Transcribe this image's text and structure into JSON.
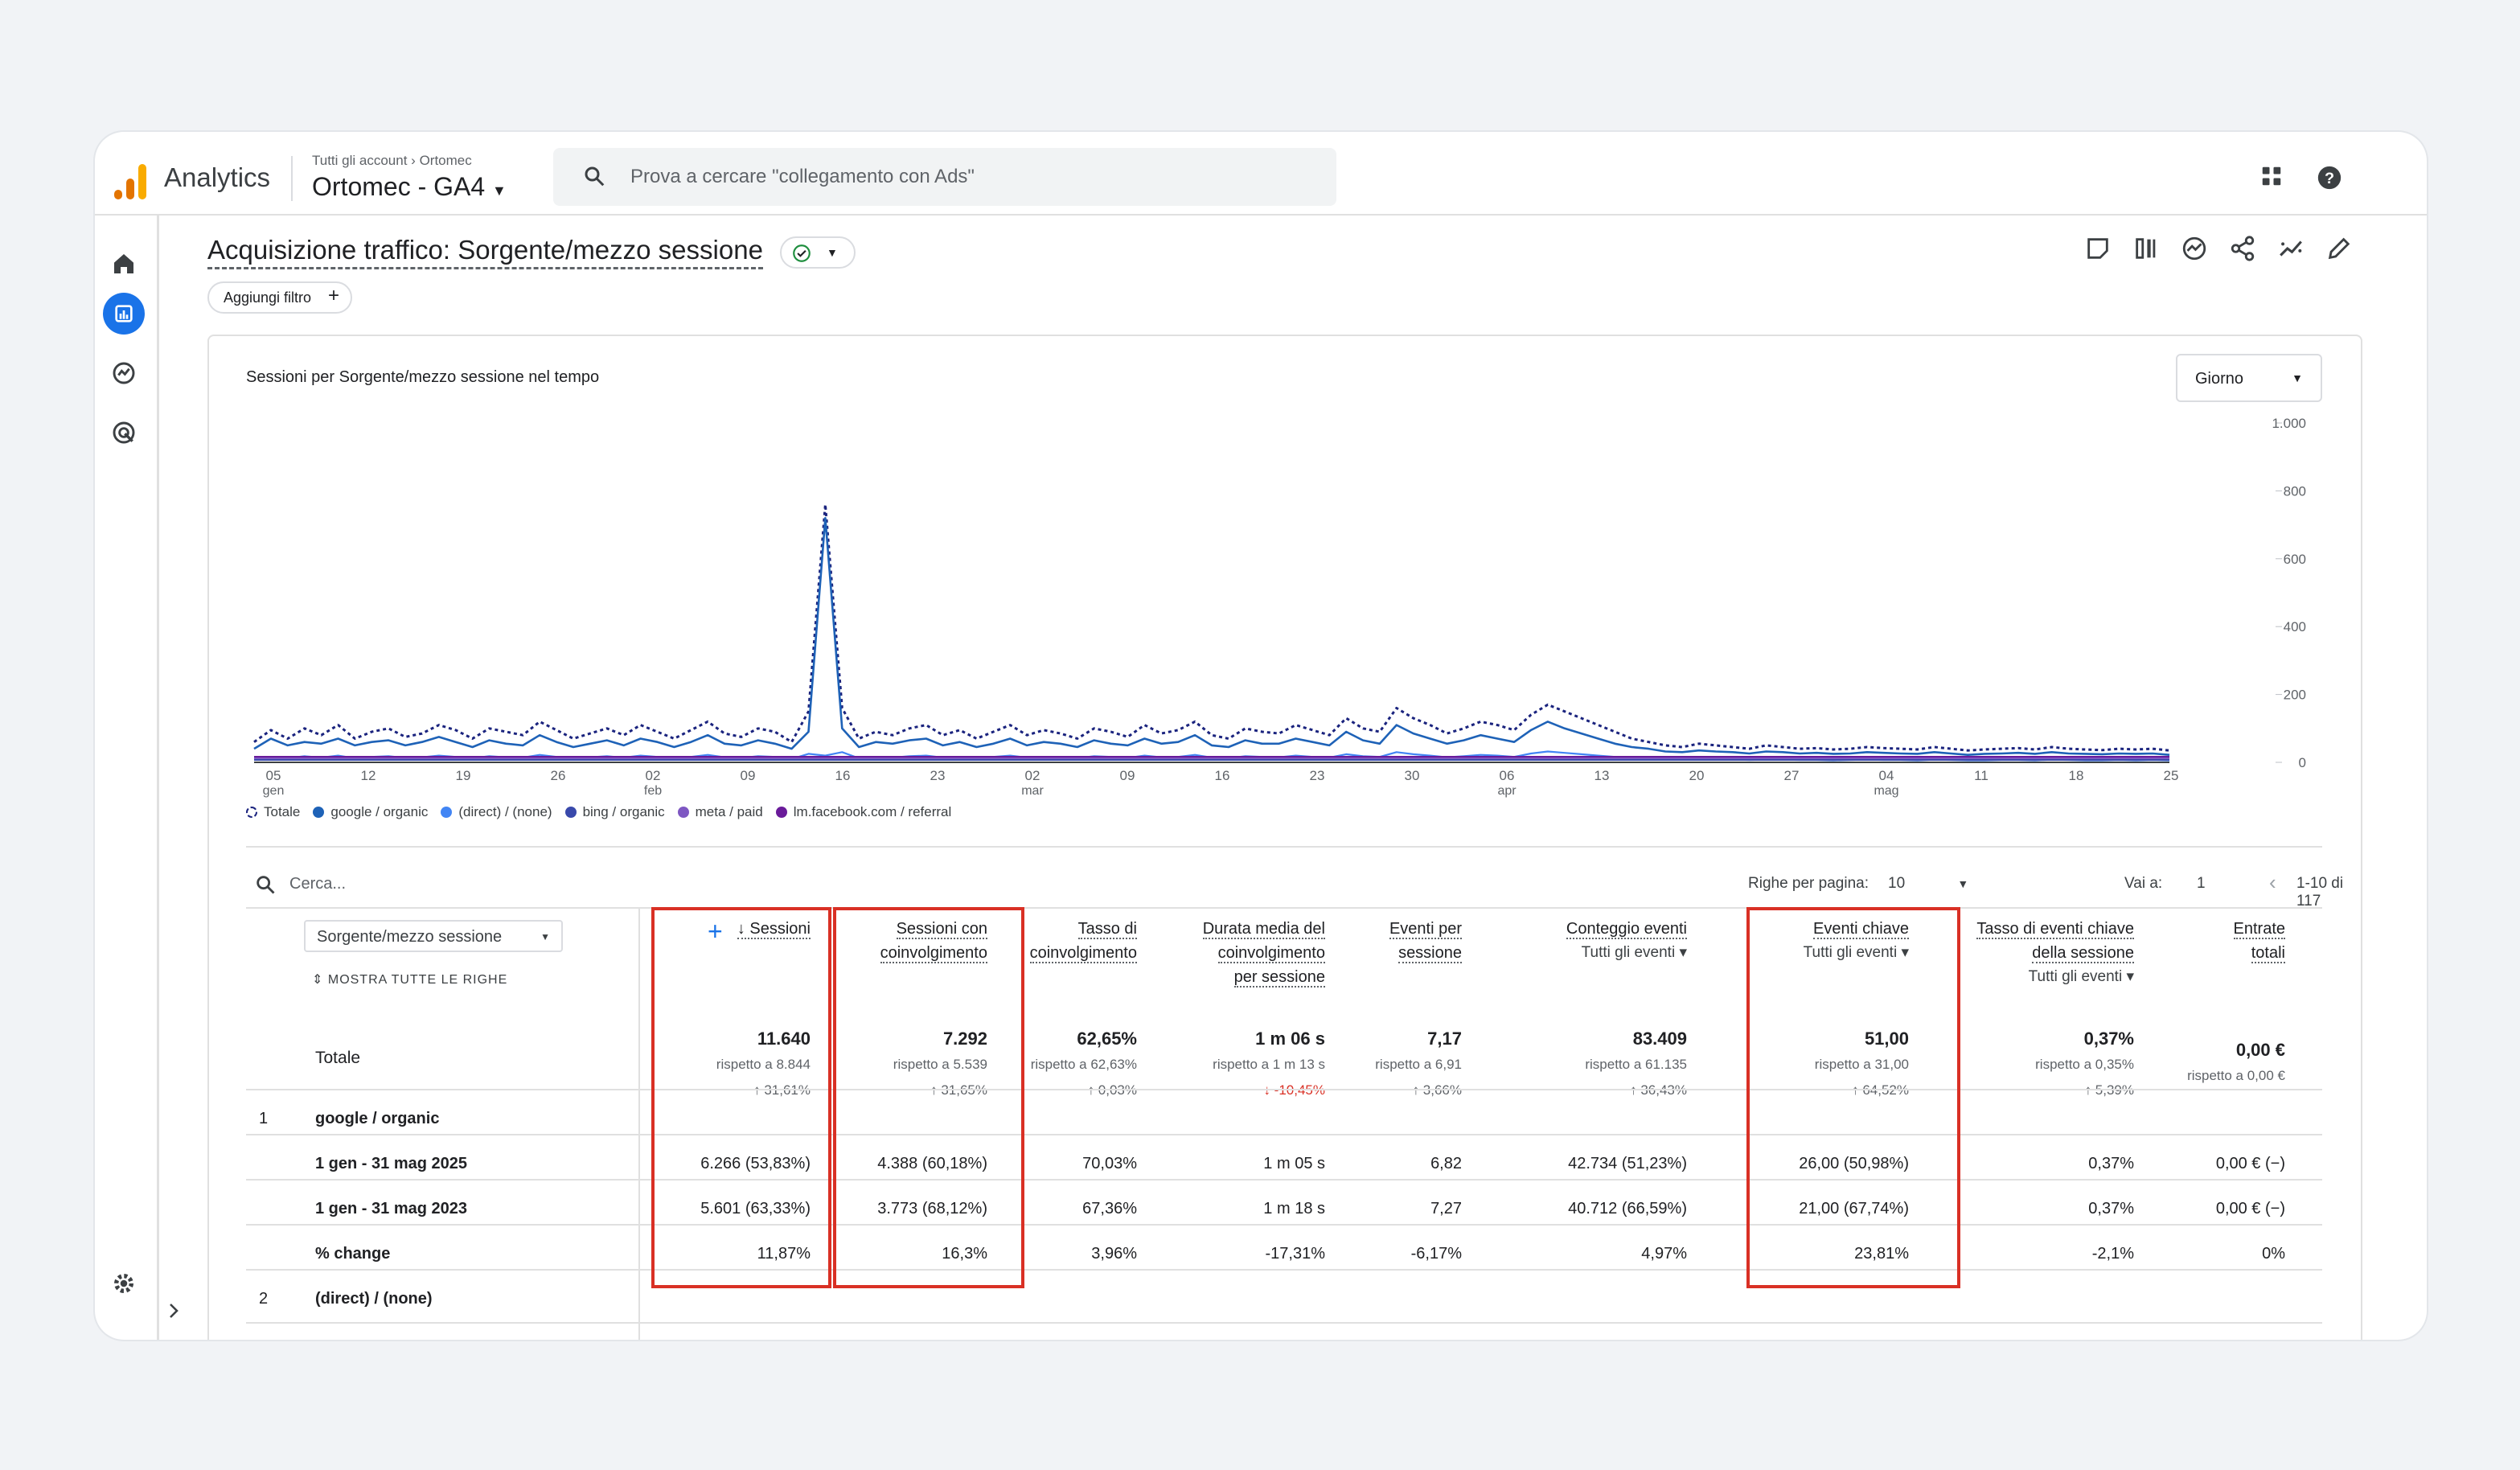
{
  "app": {
    "name": "Analytics",
    "breadcrumb_root": "Tutti gli account",
    "breadcrumb_account": "Ortomec",
    "property": "Ortomec - GA4"
  },
  "search": {
    "placeholder": "Prova a cercare \"collegamento con Ads\""
  },
  "page": {
    "title": "Acquisizione traffico: Sorgente/mezzo sessione",
    "add_filter": "Aggiungi filtro"
  },
  "chart_card": {
    "title": "Sessioni per Sorgente/mezzo sessione nel tempo",
    "granularity": "Giorno"
  },
  "chart_data": {
    "type": "line",
    "title": "Sessioni per Sorgente/mezzo sessione nel tempo",
    "y_ticks": [
      "1.000",
      "800",
      "600",
      "400",
      "200",
      "0"
    ],
    "ylim": [
      0,
      1000
    ],
    "x_ticks": [
      {
        "d": "05",
        "m": "gen"
      },
      {
        "d": "12",
        "m": ""
      },
      {
        "d": "19",
        "m": ""
      },
      {
        "d": "26",
        "m": ""
      },
      {
        "d": "02",
        "m": "feb"
      },
      {
        "d": "09",
        "m": ""
      },
      {
        "d": "16",
        "m": ""
      },
      {
        "d": "23",
        "m": ""
      },
      {
        "d": "02",
        "m": "mar"
      },
      {
        "d": "09",
        "m": ""
      },
      {
        "d": "16",
        "m": ""
      },
      {
        "d": "23",
        "m": ""
      },
      {
        "d": "30",
        "m": ""
      },
      {
        "d": "06",
        "m": "apr"
      },
      {
        "d": "13",
        "m": ""
      },
      {
        "d": "20",
        "m": ""
      },
      {
        "d": "27",
        "m": ""
      },
      {
        "d": "04",
        "m": "mag"
      },
      {
        "d": "11",
        "m": ""
      },
      {
        "d": "18",
        "m": ""
      },
      {
        "d": "25",
        "m": ""
      }
    ],
    "legend": [
      "Totale",
      "google / organic",
      "(direct) / (none)",
      "bing / organic",
      "meta / paid",
      "lm.facebook.com / referral"
    ],
    "series_colors": [
      "#1a237e",
      "#1e62b7",
      "#4285f4",
      "#3949ab",
      "#7e57c2",
      "#6a1b9a"
    ],
    "series": [
      {
        "name": "Totale",
        "values": [
          60,
          95,
          70,
          100,
          80,
          110,
          70,
          90,
          100,
          75,
          85,
          110,
          95,
          70,
          100,
          90,
          80,
          120,
          95,
          70,
          85,
          100,
          80,
          110,
          90,
          70,
          95,
          120,
          85,
          75,
          100,
          90,
          60,
          150,
          760,
          160,
          70,
          90,
          80,
          100,
          110,
          80,
          95,
          70,
          90,
          110,
          80,
          95,
          85,
          70,
          100,
          90,
          75,
          110,
          85,
          95,
          120,
          80,
          70,
          100,
          90,
          85,
          110,
          95,
          80,
          130,
          100,
          90,
          160,
          130,
          110,
          85,
          100,
          120,
          110,
          95,
          140,
          170,
          150,
          130,
          110,
          90,
          70,
          60,
          50,
          45,
          55,
          50,
          45,
          40,
          50,
          45,
          40,
          42,
          38,
          40,
          45,
          42,
          40,
          38,
          45,
          40,
          35,
          38,
          40,
          42,
          38,
          45,
          40,
          38,
          36,
          40,
          38,
          40,
          35
        ]
      },
      {
        "name": "google / organic",
        "values": [
          40,
          70,
          50,
          60,
          55,
          70,
          50,
          60,
          65,
          50,
          60,
          75,
          60,
          45,
          65,
          55,
          50,
          80,
          60,
          45,
          55,
          65,
          50,
          70,
          60,
          45,
          60,
          80,
          55,
          50,
          65,
          55,
          40,
          90,
          720,
          100,
          45,
          60,
          55,
          65,
          70,
          50,
          60,
          45,
          55,
          70,
          50,
          60,
          55,
          45,
          65,
          55,
          50,
          70,
          55,
          60,
          80,
          50,
          45,
          65,
          55,
          55,
          70,
          60,
          50,
          90,
          65,
          55,
          110,
          85,
          70,
          55,
          65,
          80,
          70,
          60,
          95,
          120,
          100,
          85,
          70,
          55,
          45,
          40,
          32,
          30,
          35,
          32,
          30,
          26,
          32,
          30,
          26,
          28,
          25,
          26,
          30,
          28,
          26,
          25,
          30,
          26,
          22,
          25,
          26,
          28,
          25,
          30,
          26,
          25,
          24,
          26,
          25,
          26,
          22
        ]
      },
      {
        "name": "(direct) / (none)",
        "values": [
          10,
          15,
          12,
          18,
          14,
          20,
          12,
          16,
          18,
          13,
          15,
          20,
          16,
          12,
          18,
          15,
          14,
          22,
          16,
          12,
          15,
          18,
          14,
          20,
          16,
          12,
          16,
          22,
          15,
          13,
          18,
          16,
          10,
          25,
          20,
          30,
          12,
          16,
          14,
          18,
          20,
          14,
          16,
          12,
          16,
          20,
          14,
          16,
          15,
          12,
          18,
          16,
          13,
          20,
          15,
          16,
          22,
          14,
          12,
          18,
          16,
          15,
          20,
          16,
          14,
          24,
          18,
          16,
          30,
          24,
          20,
          15,
          18,
          22,
          20,
          16,
          26,
          32,
          28,
          24,
          20,
          16,
          12,
          10,
          8,
          8,
          9,
          8,
          8,
          7,
          8,
          8,
          7,
          7,
          6,
          7,
          8,
          7,
          7,
          6,
          8,
          7,
          6,
          6,
          7,
          7,
          6,
          8,
          7,
          6,
          6,
          7,
          6,
          7,
          6
        ]
      }
    ]
  },
  "table": {
    "search_placeholder": "Cerca...",
    "rows_per_page_label": "Righe per pagina:",
    "rows_per_page": "10",
    "goto_label": "Vai a:",
    "goto_value": "1",
    "range": "1-10 di 117",
    "dimension": "Sorgente/mezzo sessione",
    "show_all": "MOSTRA TUTTE LE RIGHE",
    "columns": [
      {
        "lines": [
          "↓ Sessioni"
        ],
        "sub": ""
      },
      {
        "lines": [
          "Sessioni con",
          "coinvolgimento"
        ],
        "sub": ""
      },
      {
        "lines": [
          "Tasso di",
          "coinvolgimento"
        ],
        "sub": ""
      },
      {
        "lines": [
          "Durata media del",
          "coinvolgimento",
          "per sessione"
        ],
        "sub": ""
      },
      {
        "lines": [
          "Eventi per",
          "sessione"
        ],
        "sub": ""
      },
      {
        "lines": [
          "Conteggio eventi"
        ],
        "sub": "Tutti gli eventi ▾"
      },
      {
        "lines": [
          "Eventi chiave"
        ],
        "sub": "Tutti gli eventi ▾"
      },
      {
        "lines": [
          "Tasso di eventi chiave",
          "della sessione"
        ],
        "sub": "Tutti gli eventi ▾"
      },
      {
        "lines": [
          "Entrate",
          "totali"
        ],
        "sub": ""
      }
    ],
    "totals_label": "Totale",
    "totals": [
      {
        "value": "11.640",
        "cmp": "rispetto a 8.844",
        "chg": "↑ 31,61%"
      },
      {
        "value": "7.292",
        "cmp": "rispetto a 5.539",
        "chg": "↑ 31,65%"
      },
      {
        "value": "62,65%",
        "cmp": "rispetto a 62,63%",
        "chg": "↑ 0,03%"
      },
      {
        "value": "1 m 06 s",
        "cmp": "rispetto a 1 m 13 s",
        "chg": "↓ -10,45%"
      },
      {
        "value": "7,17",
        "cmp": "rispetto a 6,91",
        "chg": "↑ 3,66%"
      },
      {
        "value": "83.409",
        "cmp": "rispetto a 61.135",
        "chg": "↑ 36,43%"
      },
      {
        "value": "51,00",
        "cmp": "rispetto a 31,00",
        "chg": "↑ 64,52%"
      },
      {
        "value": "0,37%",
        "cmp": "rispetto a 0,35%",
        "chg": "↑ 5,39%"
      },
      {
        "value": "0,00 €",
        "cmp": "rispetto a 0,00 €",
        "chg": ""
      }
    ],
    "groups": [
      {
        "index": "1",
        "name": "google / organic"
      },
      {
        "index": "2",
        "name": "(direct) / (none)"
      }
    ],
    "rows": [
      {
        "label": "1 gen - 31 mag 2025",
        "cells": [
          "6.266 (53,83%)",
          "4.388 (60,18%)",
          "70,03%",
          "1 m 05 s",
          "6,82",
          "42.734 (51,23%)",
          "26,00 (50,98%)",
          "0,37%",
          "0,00 € (−)"
        ]
      },
      {
        "label": "1 gen - 31 mag 2023",
        "cells": [
          "5.601 (63,33%)",
          "3.773 (68,12%)",
          "67,36%",
          "1 m 18 s",
          "7,27",
          "40.712 (66,59%)",
          "21,00 (67,74%)",
          "0,37%",
          "0,00 € (−)"
        ]
      },
      {
        "label": "% change",
        "cells": [
          "11,87%",
          "16,3%",
          "3,96%",
          "-17,31%",
          "-6,17%",
          "4,97%",
          "23,81%",
          "-2,1%",
          "0%"
        ]
      }
    ]
  }
}
